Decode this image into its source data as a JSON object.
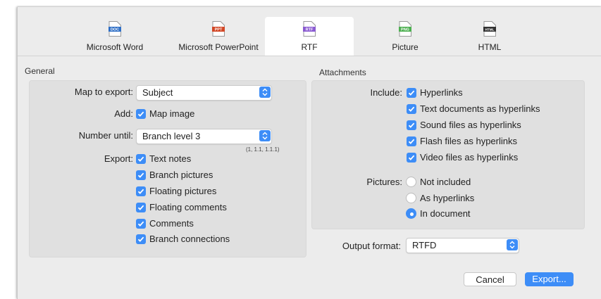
{
  "formats": [
    {
      "label": "Microsoft Word",
      "icon_text": "DOC",
      "icon_color": "#2f6fc6",
      "icon": "word-document-icon"
    },
    {
      "label": "Microsoft PowerPoint",
      "icon_text": "PPT",
      "icon_color": "#d24726",
      "icon": "powerpoint-document-icon"
    },
    {
      "label": "RTF",
      "icon_text": "RTF",
      "icon_color": "#8a5bd1",
      "icon": "rtf-document-icon"
    },
    {
      "label": "Picture",
      "icon_text": "PNG",
      "icon_color": "#4caf50",
      "icon": "picture-document-icon"
    },
    {
      "label": "HTML",
      "icon_text": "HTML",
      "icon_color": "#333333",
      "icon": "html-document-icon"
    }
  ],
  "selected_format": "RTF",
  "general": {
    "title": "General",
    "map_label": "Map to export:",
    "map_value": "Subject",
    "add_label": "Add:",
    "map_image": "Map image",
    "number_label": "Number until:",
    "number_value": "Branch level 3",
    "number_hint": "(1, 1.1, 1.1.1)",
    "export_label": "Export:",
    "export_items": [
      "Text notes",
      "Branch pictures",
      "Floating pictures",
      "Floating comments",
      "Comments",
      "Branch connections"
    ]
  },
  "attachments": {
    "title": "Attachments",
    "include_label": "Include:",
    "include_items": [
      "Hyperlinks",
      "Text documents as hyperlinks",
      "Sound files as hyperlinks",
      "Flash files as hyperlinks",
      "Video files as hyperlinks"
    ],
    "pictures_label": "Pictures:",
    "picture_options": [
      "Not included",
      "As hyperlinks",
      "In document"
    ],
    "selected_picture_option": "In document"
  },
  "output": {
    "label": "Output format:",
    "value": "RTFD"
  },
  "buttons": {
    "cancel": "Cancel",
    "export": "Export..."
  },
  "colors": {
    "accent": "#3d8df7"
  }
}
